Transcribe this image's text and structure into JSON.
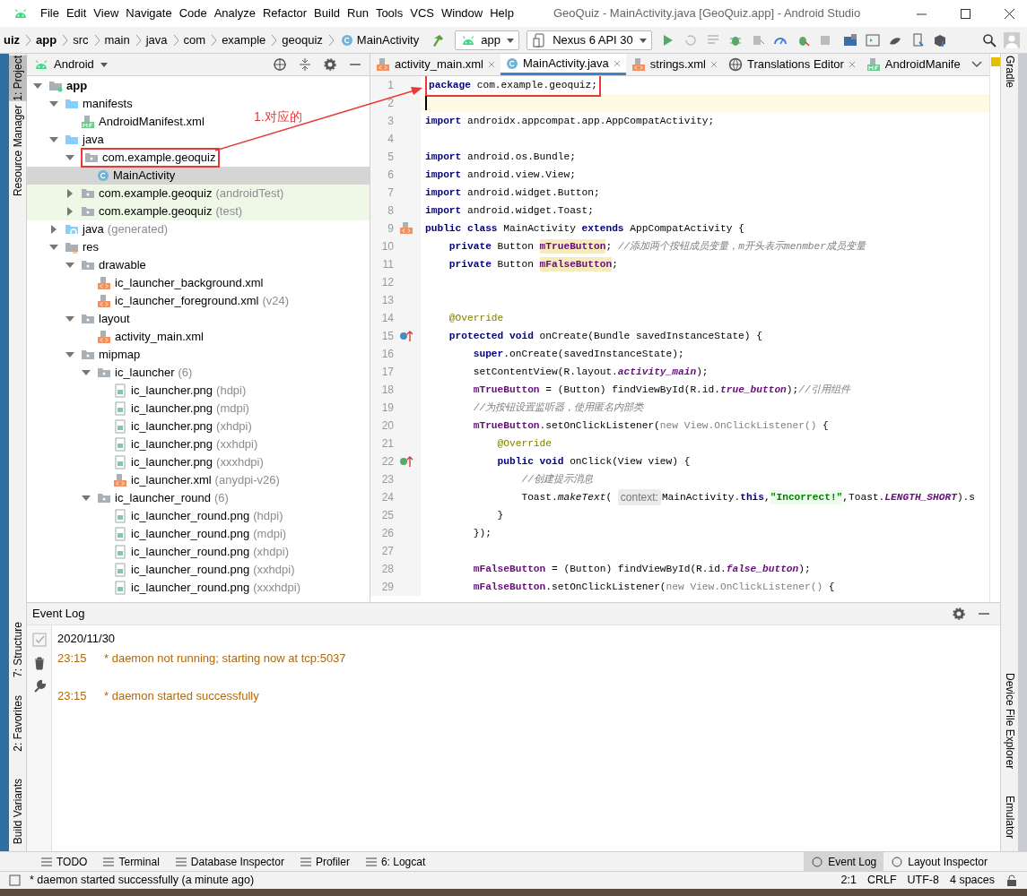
{
  "window": {
    "title": "GeoQuiz - MainActivity.java [GeoQuiz.app] - Android Studio"
  },
  "menu": [
    "File",
    "Edit",
    "View",
    "Navigate",
    "Code",
    "Analyze",
    "Refactor",
    "Build",
    "Run",
    "Tools",
    "VCS",
    "Window",
    "Help"
  ],
  "breadcrumb": [
    {
      "label": "uiz",
      "kind": "module"
    },
    {
      "label": "app",
      "kind": "module"
    },
    {
      "label": "src",
      "kind": "dir"
    },
    {
      "label": "main",
      "kind": "dir"
    },
    {
      "label": "java",
      "kind": "dir"
    },
    {
      "label": "com",
      "kind": "dir"
    },
    {
      "label": "example",
      "kind": "dir"
    },
    {
      "label": "geoquiz",
      "kind": "dir"
    },
    {
      "label": "MainActivity",
      "kind": "class"
    }
  ],
  "run_config": "app",
  "device": "Nexus 6 API 30",
  "left_tools": [
    {
      "label": "1: Project",
      "selected": true
    },
    {
      "label": "Resource Manager",
      "selected": false
    },
    {
      "label": "7: Structure",
      "selected": false
    },
    {
      "label": "2: Favorites",
      "selected": false
    },
    {
      "label": "Build Variants",
      "selected": false
    }
  ],
  "right_tools": [
    {
      "label": "Gradle"
    },
    {
      "label": "Device File Explorer"
    },
    {
      "label": "Emulator"
    }
  ],
  "project_view": {
    "mode": "Android"
  },
  "tree": [
    {
      "label": "app",
      "kind": "module",
      "expanded": true,
      "selected": false,
      "children": [
        {
          "label": "manifests",
          "kind": "folder",
          "expanded": true,
          "selected": false,
          "children": [
            {
              "label": "AndroidManifest.xml",
              "kind": "manifest",
              "selected": false
            }
          ]
        },
        {
          "label": "java",
          "kind": "folder",
          "expanded": true,
          "selected": false,
          "children": [
            {
              "label": "com.example.geoquiz",
              "kind": "package",
              "expanded": true,
              "selected": false,
              "children": [
                {
                  "label": "MainActivity",
                  "kind": "class",
                  "selected": true
                }
              ]
            },
            {
              "label": "com.example.geoquiz",
              "note": "(androidTest)",
              "kind": "test-package",
              "expanded": false,
              "selected": false
            },
            {
              "label": "com.example.geoquiz",
              "note": "(test)",
              "kind": "test-package",
              "expanded": false,
              "selected": false
            }
          ]
        },
        {
          "label": "java",
          "note": "(generated)",
          "kind": "generated",
          "expanded": false,
          "selected": false
        },
        {
          "label": "res",
          "kind": "res",
          "expanded": true,
          "selected": false,
          "children": [
            {
              "label": "drawable",
              "kind": "package",
              "expanded": true,
              "selected": false,
              "children": [
                {
                  "label": "ic_launcher_background.xml",
                  "kind": "xml",
                  "selected": false
                },
                {
                  "label": "ic_launcher_foreground.xml",
                  "note": "(v24)",
                  "kind": "xml",
                  "selected": false
                }
              ]
            },
            {
              "label": "layout",
              "kind": "package",
              "expanded": true,
              "selected": false,
              "children": [
                {
                  "label": "activity_main.xml",
                  "kind": "xml",
                  "selected": false
                }
              ]
            },
            {
              "label": "mipmap",
              "kind": "package",
              "expanded": true,
              "selected": false,
              "children": [
                {
                  "label": "ic_launcher",
                  "note": "(6)",
                  "kind": "package",
                  "expanded": true,
                  "selected": false,
                  "children": [
                    {
                      "label": "ic_launcher.png",
                      "note": "(hdpi)",
                      "kind": "image",
                      "selected": false
                    },
                    {
                      "label": "ic_launcher.png",
                      "note": "(mdpi)",
                      "kind": "image",
                      "selected": false
                    },
                    {
                      "label": "ic_launcher.png",
                      "note": "(xhdpi)",
                      "kind": "image",
                      "selected": false
                    },
                    {
                      "label": "ic_launcher.png",
                      "note": "(xxhdpi)",
                      "kind": "image",
                      "selected": false
                    },
                    {
                      "label": "ic_launcher.png",
                      "note": "(xxxhdpi)",
                      "kind": "image",
                      "selected": false
                    },
                    {
                      "label": "ic_launcher.xml",
                      "note": "(anydpi-v26)",
                      "kind": "xml",
                      "selected": false
                    }
                  ]
                },
                {
                  "label": "ic_launcher_round",
                  "note": "(6)",
                  "kind": "package",
                  "expanded": true,
                  "selected": false,
                  "children": [
                    {
                      "label": "ic_launcher_round.png",
                      "note": "(hdpi)",
                      "kind": "image",
                      "selected": false
                    },
                    {
                      "label": "ic_launcher_round.png",
                      "note": "(mdpi)",
                      "kind": "image",
                      "selected": false
                    },
                    {
                      "label": "ic_launcher_round.png",
                      "note": "(xhdpi)",
                      "kind": "image",
                      "selected": false
                    },
                    {
                      "label": "ic_launcher_round.png",
                      "note": "(xxhdpi)",
                      "kind": "image",
                      "selected": false
                    },
                    {
                      "label": "ic_launcher_round.png",
                      "note": "(xxxhdpi)",
                      "kind": "image",
                      "selected": false
                    }
                  ]
                }
              ]
            }
          ]
        }
      ]
    }
  ],
  "editor_tabs": [
    {
      "label": "activity_main.xml",
      "kind": "xml",
      "selected": false
    },
    {
      "label": "MainActivity.java",
      "kind": "class",
      "selected": true
    },
    {
      "label": "strings.xml",
      "kind": "xml",
      "selected": false
    },
    {
      "label": "Translations Editor",
      "kind": "globe",
      "selected": false
    },
    {
      "label": "AndroidManife",
      "kind": "manifest-cut",
      "selected": false
    }
  ],
  "code": [
    {
      "number": "1",
      "kind": "plain",
      "tokens": [
        {
          "kind": "kw",
          "text": "package"
        },
        {
          "kind": "plain",
          "text": " com.example.geoquiz;"
        }
      ]
    },
    {
      "number": "2",
      "kind": "caret"
    },
    {
      "number": "3",
      "kind": "plain",
      "tokens": [
        {
          "kind": "kw",
          "text": "import"
        },
        {
          "kind": "plain",
          "text": " androidx.appcompat.app.AppCompatActivity;"
        }
      ]
    },
    {
      "number": "4",
      "kind": "plain"
    },
    {
      "number": "5",
      "kind": "plain",
      "tokens": [
        {
          "kind": "kw",
          "text": "import"
        },
        {
          "kind": "plain",
          "text": " android.os.Bundle;"
        }
      ]
    },
    {
      "number": "6",
      "kind": "plain",
      "tokens": [
        {
          "kind": "kw",
          "text": "import"
        },
        {
          "kind": "plain",
          "text": " android.view.View;"
        }
      ]
    },
    {
      "number": "7",
      "kind": "plain",
      "tokens": [
        {
          "kind": "kw",
          "text": "import"
        },
        {
          "kind": "plain",
          "text": " android.widget.Button;"
        }
      ]
    },
    {
      "number": "8",
      "kind": "plain",
      "tokens": [
        {
          "kind": "kw",
          "text": "import"
        },
        {
          "kind": "plain",
          "text": " android.widget.Toast;"
        }
      ]
    },
    {
      "number": "9",
      "kind": "layout-link",
      "tokens": [
        {
          "kind": "kw",
          "text": "public class"
        },
        {
          "kind": "plain",
          "text": " MainActivity "
        },
        {
          "kind": "kw",
          "text": "extends"
        },
        {
          "kind": "plain",
          "text": " AppCompatActivity {"
        }
      ]
    },
    {
      "number": "10",
      "kind": "plain",
      "tokens": [
        {
          "kind": "kw",
          "text": "    private"
        },
        {
          "kind": "plain",
          "text": " Button "
        },
        {
          "kind": "field_decl",
          "text": "mTrueButton"
        },
        {
          "kind": "plain",
          "text": "; "
        },
        {
          "kind": "comment",
          "text": "//添加两个按钮成员变量，m开头表示menmber成员变量"
        }
      ]
    },
    {
      "number": "11",
      "kind": "plain",
      "tokens": [
        {
          "kind": "kw",
          "text": "    private"
        },
        {
          "kind": "plain",
          "text": " Button "
        },
        {
          "kind": "field_decl",
          "text": "mFalseButton"
        },
        {
          "kind": "plain",
          "text": ";"
        }
      ]
    },
    {
      "number": "12",
      "kind": "plain"
    },
    {
      "number": "13",
      "kind": "plain"
    },
    {
      "number": "14",
      "kind": "plain",
      "tokens": [
        {
          "kind": "annotation",
          "text": "    @Override"
        }
      ]
    },
    {
      "number": "15",
      "kind": "overrides",
      "tokens": [
        {
          "kind": "kw",
          "text": "    protected void"
        },
        {
          "kind": "plain",
          "text": " onCreate(Bundle savedInstanceState) {"
        }
      ]
    },
    {
      "number": "16",
      "kind": "plain",
      "tokens": [
        {
          "kind": "kw",
          "text": "        super"
        },
        {
          "kind": "plain",
          "text": ".onCreate(savedInstanceState);"
        }
      ]
    },
    {
      "number": "17",
      "kind": "plain",
      "tokens": [
        {
          "kind": "plain",
          "text": "        setContentView(R.layout."
        },
        {
          "kind": "static",
          "text": "activity_main"
        },
        {
          "kind": "plain",
          "text": ");"
        }
      ]
    },
    {
      "number": "18",
      "kind": "plain",
      "tokens": [
        {
          "kind": "field",
          "text": "        mTrueButton"
        },
        {
          "kind": "plain",
          "text": " = (Button) findViewById(R.id."
        },
        {
          "kind": "static",
          "text": "true_button"
        },
        {
          "kind": "plain",
          "text": ");"
        },
        {
          "kind": "comment",
          "text": "//引用组件"
        }
      ]
    },
    {
      "number": "19",
      "kind": "plain",
      "tokens": [
        {
          "kind": "comment",
          "text": "        //为按钮设置监听器，使用匿名内部类"
        }
      ]
    },
    {
      "number": "20",
      "kind": "plain",
      "tokens": [
        {
          "kind": "field",
          "text": "        mTrueButton"
        },
        {
          "kind": "plain",
          "text": ".setOnClickListener("
        },
        {
          "kind": "dim",
          "text": "new View.OnClickListener()"
        },
        {
          "kind": "plain",
          "text": " {"
        }
      ]
    },
    {
      "number": "21",
      "kind": "plain",
      "tokens": [
        {
          "kind": "annotation",
          "text": "            @Override"
        }
      ]
    },
    {
      "number": "22",
      "kind": "implements",
      "tokens": [
        {
          "kind": "kw",
          "text": "            public void"
        },
        {
          "kind": "plain",
          "text": " onClick(View view) {"
        }
      ]
    },
    {
      "number": "23",
      "kind": "plain",
      "tokens": [
        {
          "kind": "comment",
          "text": "                //创建提示消息"
        }
      ]
    },
    {
      "number": "24",
      "kind": "plain",
      "tokens": [
        {
          "kind": "plain",
          "text": "                Toast."
        },
        {
          "kind": "italic",
          "text": "makeText"
        },
        {
          "kind": "plain",
          "text": "( "
        },
        {
          "kind": "hint",
          "text": "context:"
        },
        {
          "kind": "plain",
          "text": "MainActivity."
        },
        {
          "kind": "kw",
          "text": "this"
        },
        {
          "kind": "plain",
          "text": ","
        },
        {
          "kind": "string",
          "text": "\"Incorrect!\""
        },
        {
          "kind": "plain",
          "text": ",Toast."
        },
        {
          "kind": "static",
          "text": "LENGTH_SHORT"
        },
        {
          "kind": "plain",
          "text": ").s"
        }
      ]
    },
    {
      "number": "25",
      "kind": "plain",
      "tokens": [
        {
          "kind": "plain",
          "text": "            }"
        }
      ]
    },
    {
      "number": "26",
      "kind": "plain",
      "tokens": [
        {
          "kind": "plain",
          "text": "        });"
        }
      ]
    },
    {
      "number": "27",
      "kind": "plain"
    },
    {
      "number": "28",
      "kind": "plain",
      "tokens": [
        {
          "kind": "field",
          "text": "        mFalseButton"
        },
        {
          "kind": "plain",
          "text": " = (Button) findViewById(R.id."
        },
        {
          "kind": "static",
          "text": "false_button"
        },
        {
          "kind": "plain",
          "text": ");"
        }
      ]
    },
    {
      "number": "29",
      "kind": "plain",
      "tokens": [
        {
          "kind": "field",
          "text": "        mFalseButton"
        },
        {
          "kind": "plain",
          "text": ".setOnClickListener("
        },
        {
          "kind": "dim",
          "text": "new View.OnClickListener()"
        },
        {
          "kind": "plain",
          "text": " {"
        }
      ]
    }
  ],
  "annotation": {
    "label": "1.对应的"
  },
  "event_log": {
    "title": "Event Log",
    "date": "2020/11/30",
    "entries": [
      {
        "time": "23:15",
        "message": "* daemon not running; starting now at tcp:5037"
      },
      {
        "time": "23:15",
        "message": "* daemon started successfully"
      }
    ]
  },
  "bottom_tools_left": [
    {
      "label": "TODO",
      "selected": false
    },
    {
      "label": "Terminal",
      "selected": false
    },
    {
      "label": "Database Inspector",
      "selected": false
    },
    {
      "label": "Profiler",
      "selected": false
    },
    {
      "label": "6: Logcat",
      "selected": false
    }
  ],
  "bottom_tools_right": [
    {
      "label": "Event Log",
      "selected": true
    },
    {
      "label": "Layout Inspector",
      "selected": false
    }
  ],
  "status_bar": {
    "message": "* daemon started successfully (a minute ago)",
    "items": [
      "2:1",
      "CRLF",
      "UTF-8",
      "4 spaces"
    ]
  }
}
